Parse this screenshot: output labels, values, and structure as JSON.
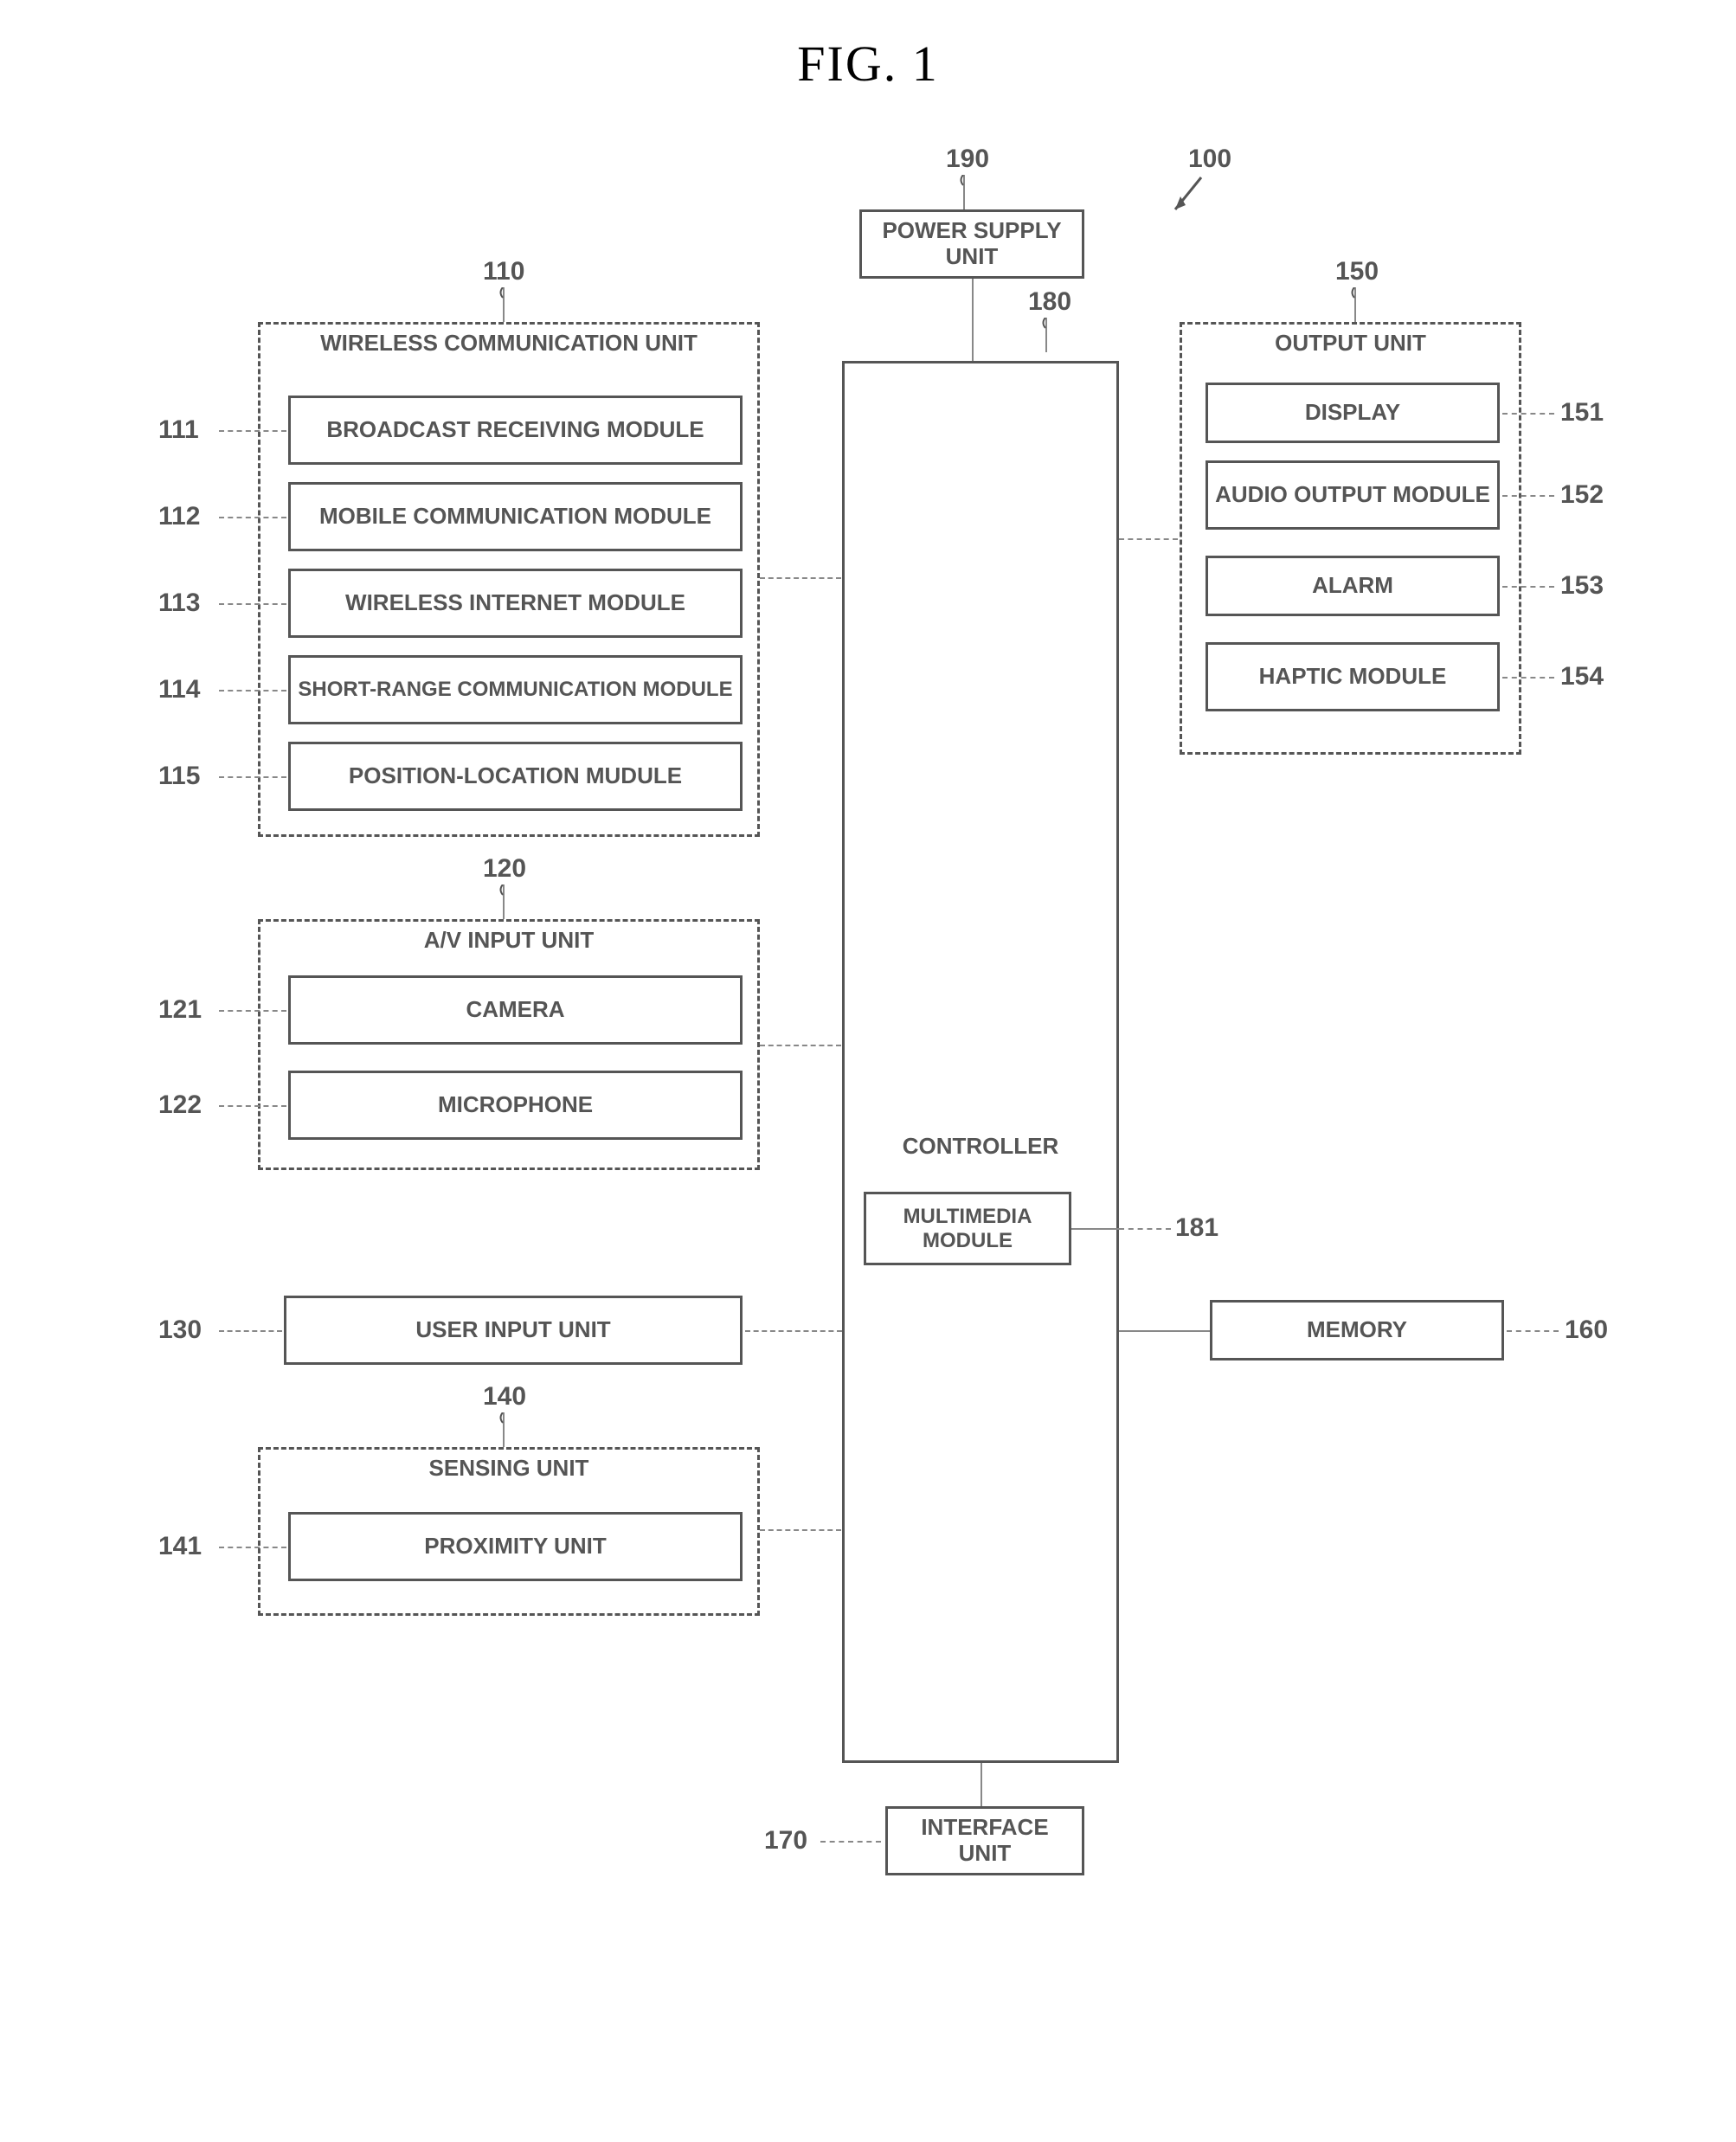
{
  "figure_title": "FIG. 1",
  "refs": {
    "r100": "100",
    "r190": "190",
    "r180": "180",
    "r110": "110",
    "r111": "111",
    "r112": "112",
    "r113": "113",
    "r114": "114",
    "r115": "115",
    "r120": "120",
    "r121": "121",
    "r122": "122",
    "r130": "130",
    "r140": "140",
    "r141": "141",
    "r150": "150",
    "r151": "151",
    "r152": "152",
    "r153": "153",
    "r154": "154",
    "r160": "160",
    "r170": "170",
    "r181": "181"
  },
  "labels": {
    "power_supply": "POWER SUPPLY UNIT",
    "controller": "CONTROLLER",
    "multimedia": "MULTIMEDIA MODULE",
    "wireless_unit": "WIRELESS COMMUNICATION UNIT",
    "broadcast": "BROADCAST RECEIVING MODULE",
    "mobile_comm": "MOBILE COMMUNICATION MODULE",
    "wireless_internet": "WIRELESS INTERNET MODULE",
    "short_range": "SHORT-RANGE COMMUNICATION MODULE",
    "position": "POSITION-LOCATION MUDULE",
    "av_input": "A/V INPUT UNIT",
    "camera": "CAMERA",
    "microphone": "MICROPHONE",
    "user_input": "USER INPUT UNIT",
    "sensing": "SENSING UNIT",
    "proximity": "PROXIMITY UNIT",
    "interface": "INTERFACE UNIT",
    "output_unit": "OUTPUT UNIT",
    "display": "DISPLAY",
    "audio_output": "AUDIO OUTPUT MODULE",
    "alarm": "ALARM",
    "haptic": "HAPTIC MODULE",
    "memory": "MEMORY"
  }
}
